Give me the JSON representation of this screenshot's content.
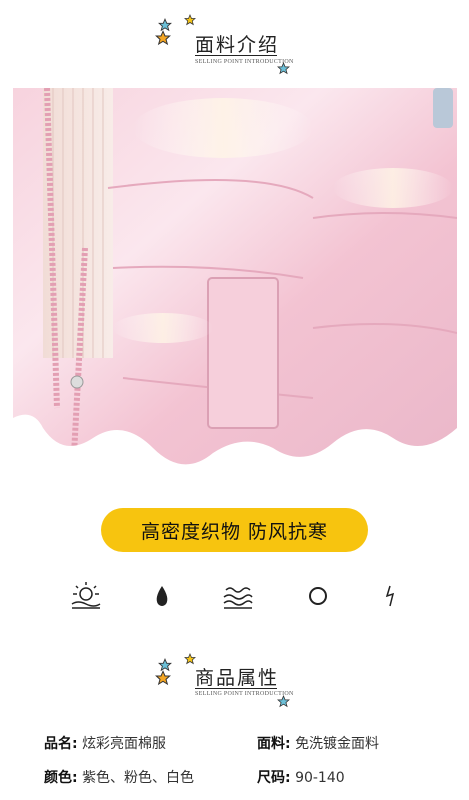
{
  "section1": {
    "title": "面料介绍",
    "subtitle": "SELLING POINT INTRODUCTION"
  },
  "banner": {
    "text": "高密度织物  防风抗寒"
  },
  "features": [
    {
      "icon": "sun-icon"
    },
    {
      "icon": "water-drop-icon"
    },
    {
      "icon": "wave-icon"
    },
    {
      "icon": "circle-icon"
    },
    {
      "icon": "lightning-icon"
    }
  ],
  "section2": {
    "title": "商品属性",
    "subtitle": "SELLING POINT INTRODUCTION"
  },
  "attributes": [
    {
      "key": "品名:",
      "value": "炫彩亮面棉服"
    },
    {
      "key": "面料:",
      "value": "免洗镀金面料"
    },
    {
      "key": "颜色:",
      "value": "紫色、粉色、白色"
    },
    {
      "key": "尺码:",
      "value": "90-140"
    }
  ],
  "colors": {
    "banner": "#f7c40f",
    "star_orange": "#f5a623",
    "star_blue": "#6cc0d8",
    "jacket_pink": "#f4c9d6"
  }
}
